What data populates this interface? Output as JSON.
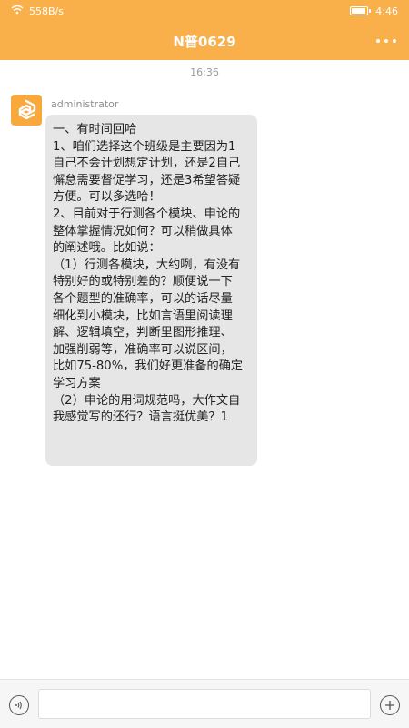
{
  "status_bar": {
    "network_speed": "558B/s",
    "time": "4:46",
    "battery_level": 0.9,
    "icons": [
      "wifi-icon",
      "battery-icon"
    ]
  },
  "header": {
    "title": "N普0629",
    "more_icon": "more-horizontal-icon"
  },
  "chat": {
    "timestamp": "16:36",
    "message": {
      "sender": "administrator",
      "avatar_icon": "app-logo-icon",
      "lines": [
        "一、有时间回哈",
        "1、咱们选择这个班级是主要因为1",
        "自己不会计划想定计划，还是2自己",
        "懈怠需要督促学习，还是3希望答疑",
        "方便。可以多选哈！",
        "2、目前对于行测各个模块、申论的",
        "整体掌握情况如何？可以稍做具体",
        "的阐述哦。比如说：",
        "（1）行测各模块，大约咧，有没有",
        "特别好的或特别差的？顺便说一下",
        "各个题型的准确率，可以的话尽量",
        "细化到小模块，比如言语里阅读理",
        "解、逻辑填空，判断里图形推理、",
        "加强削弱等，准确率可以说区间，",
        "比如75-80%，我们好更准备的确定",
        "学习方案",
        "（2）申论的用词规范吗，大作文自",
        "我感觉写的还行？语言挺优美？1"
      ]
    }
  },
  "input_bar": {
    "placeholder": "",
    "value": "",
    "voice_icon": "voice-icon",
    "add_icon": "plus-circle-icon"
  },
  "colors": {
    "accent": "#f9b04b",
    "bubble": "#e6e6e6"
  }
}
